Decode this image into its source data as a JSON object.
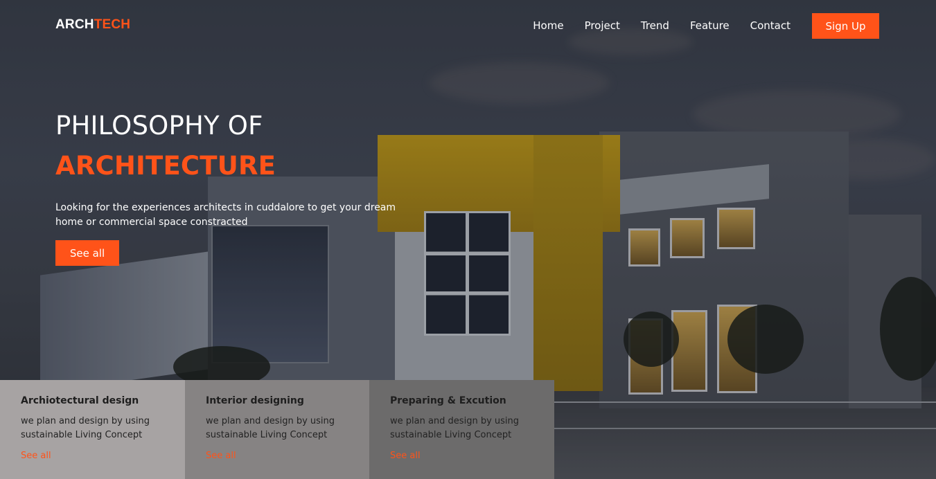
{
  "brand": {
    "part1": "ARCH",
    "part2": "TECH",
    "accent_color": "#ff5319"
  },
  "nav": {
    "items": [
      {
        "label": "Home"
      },
      {
        "label": "Project"
      },
      {
        "label": "Trend"
      },
      {
        "label": "Feature"
      },
      {
        "label": "Contact"
      }
    ],
    "signup_label": "Sign Up"
  },
  "hero": {
    "title_line1": "PHILOSOPHY OF",
    "title_line2": "ARCHITECTURE",
    "description": "Looking for the experiences architects in cuddalore to get your dream home or commercial space constracted",
    "cta_label": "See all",
    "background_image": "modern building at dusk"
  },
  "cards": [
    {
      "title": "Archiotectural design",
      "text": "we plan and design by using sustainable Living Concept",
      "link": "See all"
    },
    {
      "title": "Interior designing",
      "text": "we plan and design by using sustainable Living Concept",
      "link": "See all"
    },
    {
      "title": "Preparing & Excution",
      "text": "we plan and design by using sustainable Living Concept",
      "link": "See all"
    }
  ]
}
